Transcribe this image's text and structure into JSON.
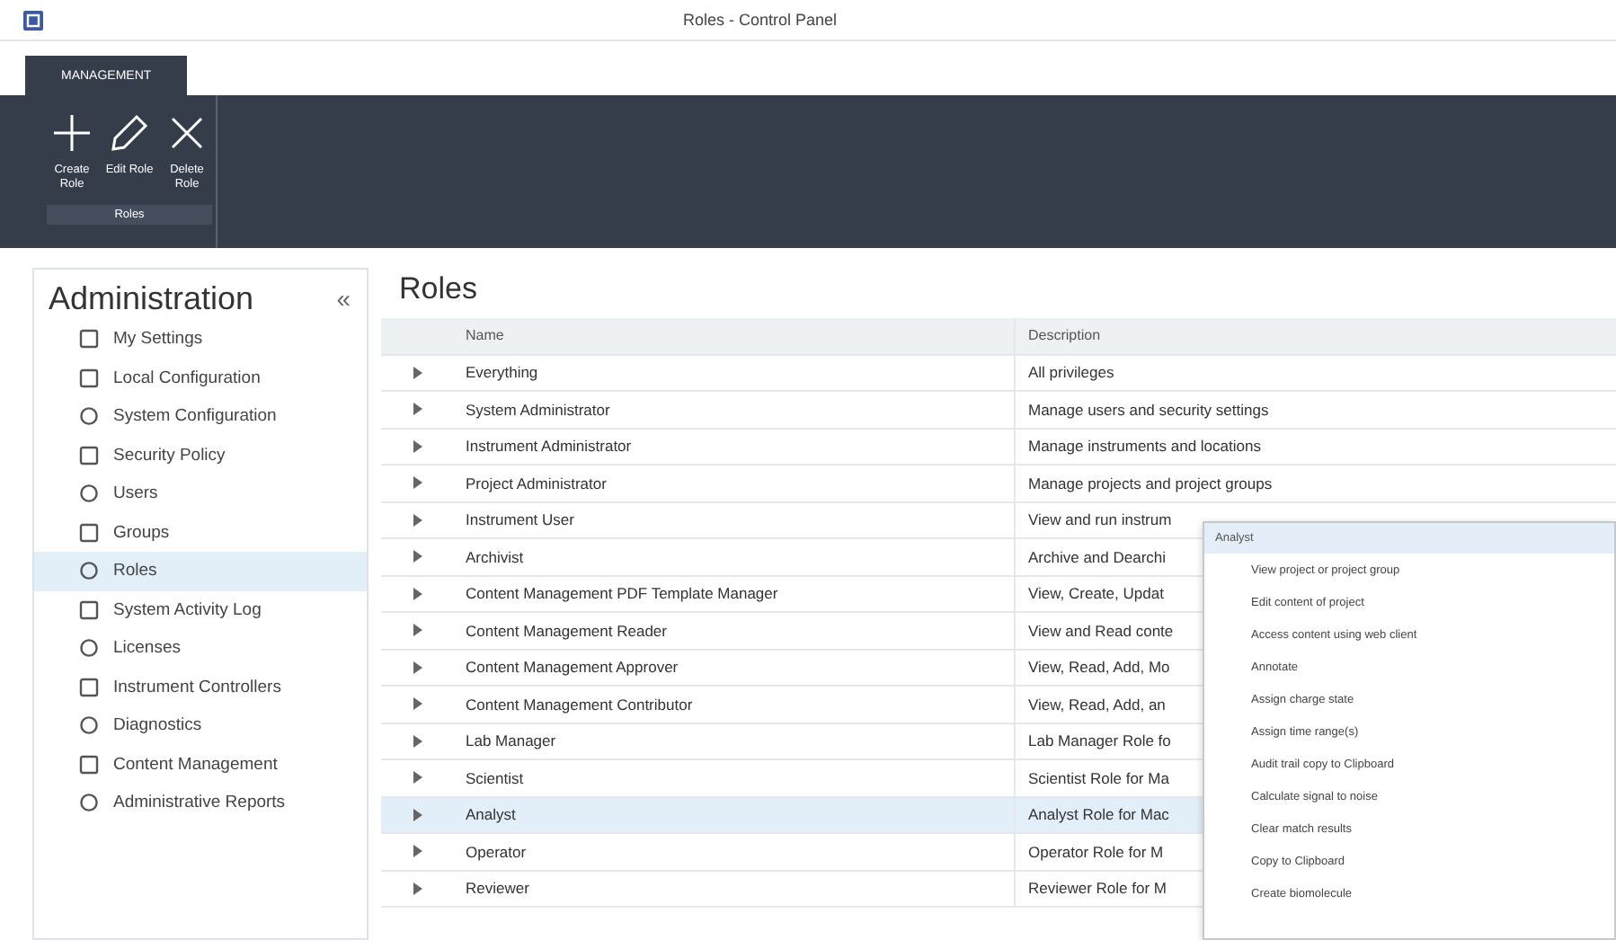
{
  "window": {
    "title": "Roles - Control Panel"
  },
  "ribbon": {
    "tabs": [
      {
        "label": "MANAGEMENT",
        "selected": true
      }
    ],
    "groups": [
      {
        "label": "Roles",
        "buttons": [
          {
            "kind": "plus",
            "label": "Create Role"
          },
          {
            "kind": "pencil",
            "label": "Edit Role"
          },
          {
            "kind": "cross",
            "label": "Delete Role"
          }
        ]
      }
    ]
  },
  "sidebar": {
    "title": "Administration",
    "collapse": "«",
    "items": [
      {
        "label": "My Settings",
        "selected": false
      },
      {
        "label": "Local Configuration",
        "selected": false
      },
      {
        "label": "System Configuration",
        "selected": false
      },
      {
        "label": "Security Policy",
        "selected": false
      },
      {
        "label": "Users",
        "selected": false
      },
      {
        "label": "Groups",
        "selected": false
      },
      {
        "label": "Roles",
        "selected": true
      },
      {
        "label": "System Activity Log",
        "selected": false
      },
      {
        "label": "Licenses",
        "selected": false
      },
      {
        "label": "Instrument Controllers",
        "selected": false
      },
      {
        "label": "Diagnostics",
        "selected": false
      },
      {
        "label": "Content Management",
        "selected": false
      },
      {
        "label": "Administrative Reports",
        "selected": false
      }
    ]
  },
  "main": {
    "title": "Roles",
    "table": {
      "columns": [
        "Name",
        "Description"
      ],
      "rows": [
        {
          "name": "Everything",
          "description": "All privileges",
          "selected": false
        },
        {
          "name": "System Administrator",
          "description": "Manage users and security settings",
          "selected": false
        },
        {
          "name": "Instrument Administrator",
          "description": "Manage instruments and locations",
          "selected": false
        },
        {
          "name": "Project Administrator",
          "description": "Manage projects and project groups",
          "selected": false
        },
        {
          "name": "Instrument User",
          "description": "View and run instrum",
          "selected": false
        },
        {
          "name": "Archivist",
          "description": "Archive and Dearchi",
          "selected": false
        },
        {
          "name": "Content Management PDF Template Manager",
          "description": "View, Create, Updat",
          "selected": false
        },
        {
          "name": "Content Management Reader",
          "description": "View and Read conte",
          "selected": false
        },
        {
          "name": "Content Management Approver",
          "description": "View, Read, Add, Mo",
          "selected": false
        },
        {
          "name": "Content Management Contributor",
          "description": "View, Read, Add, an",
          "selected": false
        },
        {
          "name": "Lab Manager",
          "description": "Lab Manager Role fo",
          "selected": false
        },
        {
          "name": "Scientist",
          "description": "Scientist Role for Ma",
          "selected": false
        },
        {
          "name": "Analyst",
          "description": "Analyst Role for Mac",
          "selected": true
        },
        {
          "name": "Operator",
          "description": "Operator Role for M",
          "selected": false
        },
        {
          "name": "Reviewer",
          "description": "Reviewer Role for M",
          "selected": false
        }
      ]
    }
  },
  "popup": {
    "title": "Analyst",
    "items": [
      "View project or project group",
      "Edit content of project",
      "Access content using web client",
      "Annotate",
      "Assign charge state",
      "Assign time range(s)",
      "Audit trail copy to Clipboard",
      "Calculate signal to noise",
      "Clear match results",
      "Copy to Clipboard",
      "Create biomolecule"
    ]
  }
}
